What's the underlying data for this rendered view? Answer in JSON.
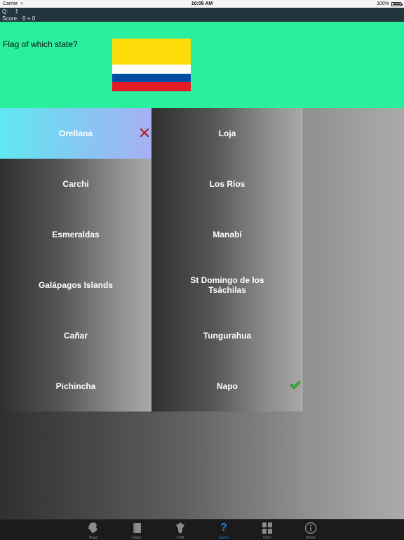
{
  "status": {
    "carrier": "Carrier",
    "time": "10:09 AM",
    "battery": "100%"
  },
  "score": {
    "q_label": "Q:",
    "q_value": "1",
    "score_label": "Score:",
    "score_value": "0 + 0"
  },
  "question": {
    "prompt": "Flag of which state?",
    "flag": "colombia-style-flag",
    "colors": [
      "#fcdd09",
      "#ffffff",
      "#034ea2",
      "#e31c24"
    ]
  },
  "answers": {
    "left": [
      {
        "label": "Orellana",
        "state": "selected-wrong"
      },
      {
        "label": "Carchi"
      },
      {
        "label": "Esmeraldas"
      },
      {
        "label": "Galápagos Islands"
      },
      {
        "label": "Cañar"
      },
      {
        "label": "Pichincha"
      }
    ],
    "right": [
      {
        "label": "Loja"
      },
      {
        "label": "Los Ríos"
      },
      {
        "label": "Manabí"
      },
      {
        "label": "St Domingo de los Tsáchilas"
      },
      {
        "label": "Tungurahua"
      },
      {
        "label": "Napo",
        "state": "correct"
      }
    ]
  },
  "tabs": [
    {
      "label": "Maps",
      "icon": "map-icon"
    },
    {
      "label": "Flags",
      "icon": "book-icon"
    },
    {
      "label": "COA",
      "icon": "emblem-icon"
    },
    {
      "label": "Game",
      "icon": "question-icon",
      "active": true
    },
    {
      "label": "Other",
      "icon": "grid-icon"
    },
    {
      "label": "About",
      "icon": "info-icon"
    }
  ],
  "accent": "#1e7fe0"
}
